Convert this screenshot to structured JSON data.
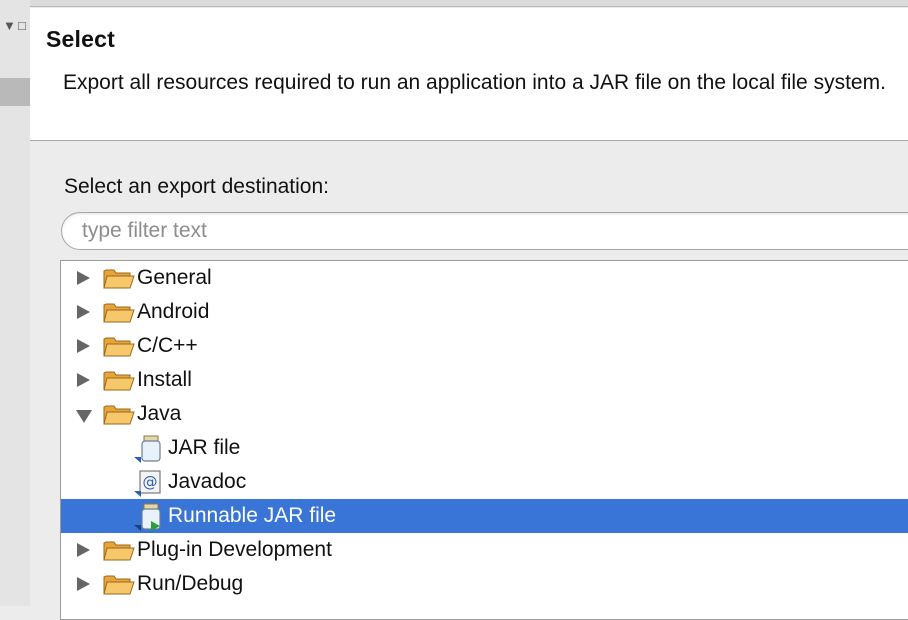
{
  "header": {
    "title": "Select",
    "description": "Export all resources required to run an application into a JAR file on the local file system."
  },
  "destination": {
    "prompt": "Select an export destination:",
    "filter_placeholder": "type filter text",
    "filter_value": ""
  },
  "tree": {
    "items": [
      {
        "label": "General",
        "expanded": false
      },
      {
        "label": "Android",
        "expanded": false
      },
      {
        "label": "C/C++",
        "expanded": false
      },
      {
        "label": "Install",
        "expanded": false
      },
      {
        "label": "Java",
        "expanded": true
      },
      {
        "label": "JAR file",
        "child_of": "Java",
        "icon": "jar-file-icon"
      },
      {
        "label": "Javadoc",
        "child_of": "Java",
        "icon": "javadoc-icon"
      },
      {
        "label": "Runnable JAR file",
        "child_of": "Java",
        "icon": "runnable-jar-icon",
        "selected": true
      },
      {
        "label": "Plug-in Development",
        "expanded": false
      },
      {
        "label": "Run/Debug",
        "expanded": false
      }
    ]
  },
  "colors": {
    "selection": "#3875d7",
    "folder": "#f2b24a",
    "header_background": "#ffffff",
    "dialog_background": "#ececec"
  }
}
